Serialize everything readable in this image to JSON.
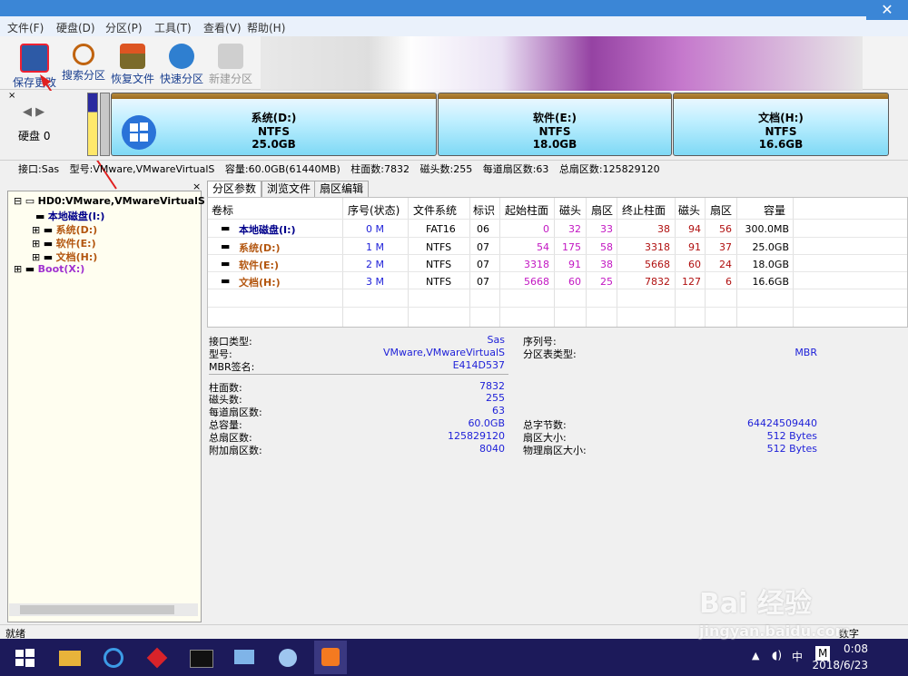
{
  "window": {
    "close_glyph": "✕"
  },
  "menu": [
    "文件(F)",
    "硬盘(D)",
    "分区(P)",
    "工具(T)",
    "查看(V)",
    "帮助(H)"
  ],
  "toolbar": [
    {
      "label": "保存更改",
      "icon": "save-icon",
      "enabled": true
    },
    {
      "label": "搜索分区",
      "icon": "search-icon",
      "enabled": true
    },
    {
      "label": "恢复文件",
      "icon": "recover-file-icon",
      "enabled": true
    },
    {
      "label": "快速分区",
      "icon": "quick-partition-icon",
      "enabled": true
    },
    {
      "label": "新建分区",
      "icon": "new-partition-icon",
      "enabled": false
    }
  ],
  "disk_map": {
    "disk_label": "硬盘 0",
    "partitions": [
      {
        "name": "系统(D:)",
        "fs": "NTFS",
        "size": "25.0GB"
      },
      {
        "name": "软件(E:)",
        "fs": "NTFS",
        "size": "18.0GB"
      },
      {
        "name": "文档(H:)",
        "fs": "NTFS",
        "size": "16.6GB"
      }
    ]
  },
  "disk_info": {
    "interface": "接口:Sas",
    "model": "型号:VMware,VMwareVirtualS",
    "capacity": "容量:60.0GB(61440MB)",
    "cylinders": "柱面数:7832",
    "heads": "磁头数:255",
    "sectors_per_track": "每道扇区数:63",
    "total_sectors": "总扇区数:125829120"
  },
  "tree": {
    "disk": "HD0:VMware,VMwareVirtualS",
    "local": "本地磁盘(I:)",
    "items": [
      "系统(D:)",
      "软件(E:)",
      "文档(H:)"
    ],
    "boot": "Boot(X:)"
  },
  "tabs": [
    "分区参数",
    "浏览文件",
    "扇区编辑"
  ],
  "table": {
    "headers": [
      "卷标",
      "序号(状态)",
      "文件系统",
      "标识",
      "起始柱面",
      "磁头",
      "扇区",
      "终止柱面",
      "磁头",
      "扇区",
      "容量"
    ],
    "rows": [
      {
        "name": "本地磁盘(I:)",
        "seq": "0 M",
        "fs": "FAT16",
        "id": "06",
        "sc": "0",
        "sh": "32",
        "ss": "33",
        "ec": "38",
        "eh": "94",
        "es": "56",
        "cap": "300.0MB"
      },
      {
        "name": "系统(D:)",
        "seq": "1 M",
        "fs": "NTFS",
        "id": "07",
        "sc": "54",
        "sh": "175",
        "ss": "58",
        "ec": "3318",
        "eh": "91",
        "es": "37",
        "cap": "25.0GB"
      },
      {
        "name": "软件(E:)",
        "seq": "2 M",
        "fs": "NTFS",
        "id": "07",
        "sc": "3318",
        "sh": "91",
        "ss": "38",
        "ec": "5668",
        "eh": "60",
        "es": "24",
        "cap": "18.0GB"
      },
      {
        "name": "文档(H:)",
        "seq": "3 M",
        "fs": "NTFS",
        "id": "07",
        "sc": "5668",
        "sh": "60",
        "ss": "25",
        "ec": "7832",
        "eh": "127",
        "es": "6",
        "cap": "16.6GB"
      }
    ]
  },
  "details": {
    "interface_type_label": "接口类型:",
    "interface_type": "Sas",
    "model_label": "型号:",
    "model": "VMware,VMwareVirtualS",
    "mbr_sig_label": "MBR签名:",
    "mbr_sig": "E414D537",
    "serial_label": "序列号:",
    "serial": "",
    "table_type_label": "分区表类型:",
    "table_type": "MBR",
    "cyl_label": "柱面数:",
    "cyl": "7832",
    "heads_label": "磁头数:",
    "heads": "255",
    "spt_label": "每道扇区数:",
    "spt": "63",
    "cap_label": "总容量:",
    "cap": "60.0GB",
    "total_bytes_label": "总字节数:",
    "total_bytes": "64424509440",
    "tsec_label": "总扇区数:",
    "tsec": "125829120",
    "secsize_label": "扇区大小:",
    "secsize": "512 Bytes",
    "extra_label": "附加扇区数:",
    "extra": "8040",
    "phys_label": "物理扇区大小:",
    "phys": "512 Bytes"
  },
  "status": {
    "left": "就绪",
    "right": "数字"
  },
  "taskbar": {
    "time": "0:08",
    "date": "2018/6/23",
    "ime": "中",
    "ime2": "M"
  },
  "watermark": {
    "text": "Bai 经验",
    "sub": "jingyan.baidu.com"
  }
}
